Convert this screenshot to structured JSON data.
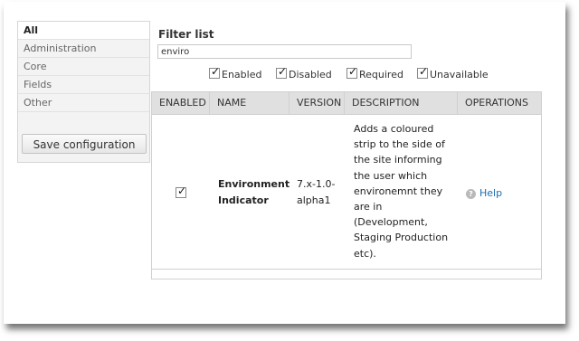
{
  "sidebar": {
    "items": [
      {
        "label": "All"
      },
      {
        "label": "Administration"
      },
      {
        "label": "Core"
      },
      {
        "label": "Fields"
      },
      {
        "label": "Other"
      }
    ],
    "save_label": "Save configuration"
  },
  "filter": {
    "title": "Filter list",
    "value": "enviro",
    "checkboxes": [
      {
        "label": "Enabled",
        "checked": true
      },
      {
        "label": "Disabled",
        "checked": true
      },
      {
        "label": "Required",
        "checked": true
      },
      {
        "label": "Unavailable",
        "checked": true
      }
    ]
  },
  "table": {
    "headers": [
      "ENABLED",
      "NAME",
      "VERSION",
      "DESCRIPTION",
      "OPERATIONS"
    ],
    "rows": [
      {
        "enabled": true,
        "name_line1": "Environment",
        "name_line2": "Indicator",
        "version_line1": "7.x-1.0-",
        "version_line2": "alpha1",
        "description_lines": [
          "Adds a coloured",
          "strip to the side of",
          "the site informing",
          "the user which",
          "environemnt they",
          "are in",
          "(Development,",
          "Staging Production",
          "etc)."
        ],
        "operation": "Help"
      }
    ]
  }
}
